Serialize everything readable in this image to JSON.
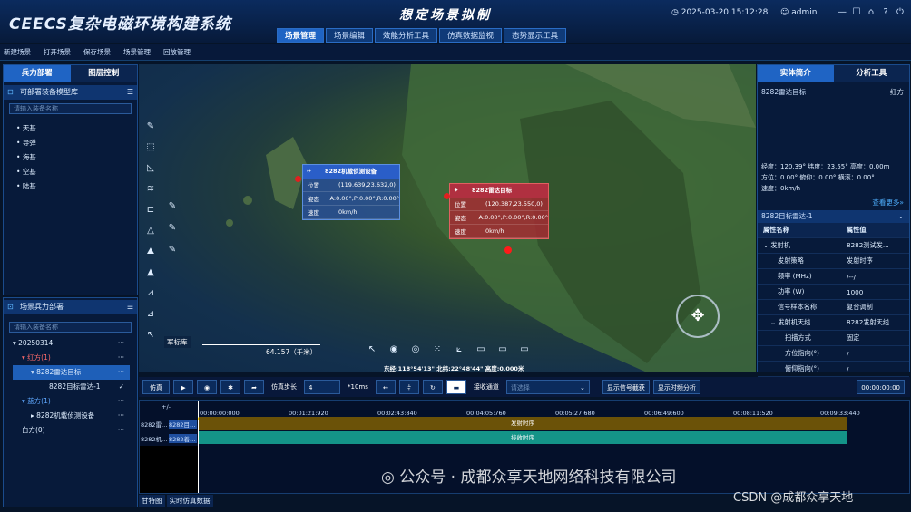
{
  "header": {
    "app_title": "CEECS复杂电磁环境构建系统",
    "page_title": "想定场景拟制",
    "datetime": "2025-03-20 15:12:28",
    "user": "admin",
    "tabs": [
      "场景管理",
      "场景编辑",
      "效能分析工具",
      "仿真数据监视",
      "态势显示工具"
    ]
  },
  "menu": [
    "新建场景",
    "打开场景",
    "保存场景",
    "场景管理",
    "回放管理"
  ],
  "left": {
    "tabs": [
      "兵力部署",
      "图层控制"
    ],
    "lib_title": "可部署装备模型库",
    "lib_search": "请输入装备名称",
    "lib_items": [
      "天基",
      "导弹",
      "海基",
      "空基",
      "陆基"
    ],
    "deploy_title": "场景兵力部署",
    "deploy_search": "请输入装备名称",
    "tree": {
      "root": "20250314",
      "red": "红方(1)",
      "red_item": "8282雷达目标",
      "red_sub": "8282目标雷达-1",
      "blue": "蓝方(1)",
      "blue_item": "8282机载侦测设备",
      "white": "白方(0)"
    }
  },
  "map": {
    "popup_blue": {
      "title": "8282机载侦测设备",
      "rows": [
        [
          "位置",
          "(119.639,23.632,0)"
        ],
        [
          "姿态",
          "A:0.00°,P:0.00°,R:0.00°"
        ],
        [
          "速度",
          "0km/h"
        ]
      ]
    },
    "popup_red": {
      "title": "8282雷达目标",
      "rows": [
        [
          "位置",
          "(120.387,23.550,0)"
        ],
        [
          "姿态",
          "A:0.00°,P:0.00°,R:0.00°"
        ],
        [
          "速度",
          "0km/h"
        ]
      ]
    },
    "armory_label": "军标库",
    "scale": "64.157（千米）",
    "coords": "东经:118°54'13\" 北纬:22°48'44\" 高度:0.000米"
  },
  "right": {
    "tabs": [
      "实体简介",
      "分析工具"
    ],
    "entity": "8282雷达目标",
    "side": "红方",
    "info": [
      "经度：120.39°  纬度：23.55°   高度：0.00m",
      "方位：0.00°   俯仰：0.00°    横滚：0.00°",
      "速度：0km/h"
    ],
    "more": "查看更多»",
    "subtitle": "8282目标雷达-1",
    "col_name": "属性名称",
    "col_val": "属性值",
    "attrs": [
      [
        "发射机",
        "8282测试发..."
      ],
      [
        "发射策略",
        "发射时序"
      ],
      [
        "频率 (MHz)",
        "/--/"
      ],
      [
        "功率 (W)",
        "1000"
      ],
      [
        "信号样本名称",
        "复合调制"
      ],
      [
        "发射机天线",
        "8282发射天线"
      ],
      [
        "扫描方式",
        "固定"
      ],
      [
        "方位指向(°)",
        "/"
      ],
      [
        "俯仰指向(°)",
        "/"
      ]
    ]
  },
  "control": {
    "sim": "仿真",
    "step_label": "仿真步长",
    "step_value": "4",
    "step_unit": "*10ms",
    "recv_label": "接收通道",
    "recv_placeholder": "请选择",
    "show_signal": "显示信号截获",
    "show_freq": "显示时频分析",
    "time": "00:00:00:00"
  },
  "gantt": {
    "plus": "+/-",
    "ticks": [
      "00:00:00:000",
      "00:01:21:920",
      "00:02:43:840",
      "00:04:05:760",
      "00:05:27:680",
      "00:06:49:600",
      "00:08:11:520",
      "00:09:33:440"
    ],
    "rows": [
      {
        "label": "8282雷…",
        "sub": "8282目…",
        "bar": "发射时序"
      },
      {
        "label": "8282机…",
        "sub": "8282着…",
        "bar": "接收时序"
      }
    ]
  },
  "bottom_tabs": [
    "甘特图",
    "实时仿真数据"
  ],
  "watermark": {
    "wechat": "公众号 · 成都众享天地网络科技有限公司",
    "csdn": "CSDN @成都众享天地"
  }
}
